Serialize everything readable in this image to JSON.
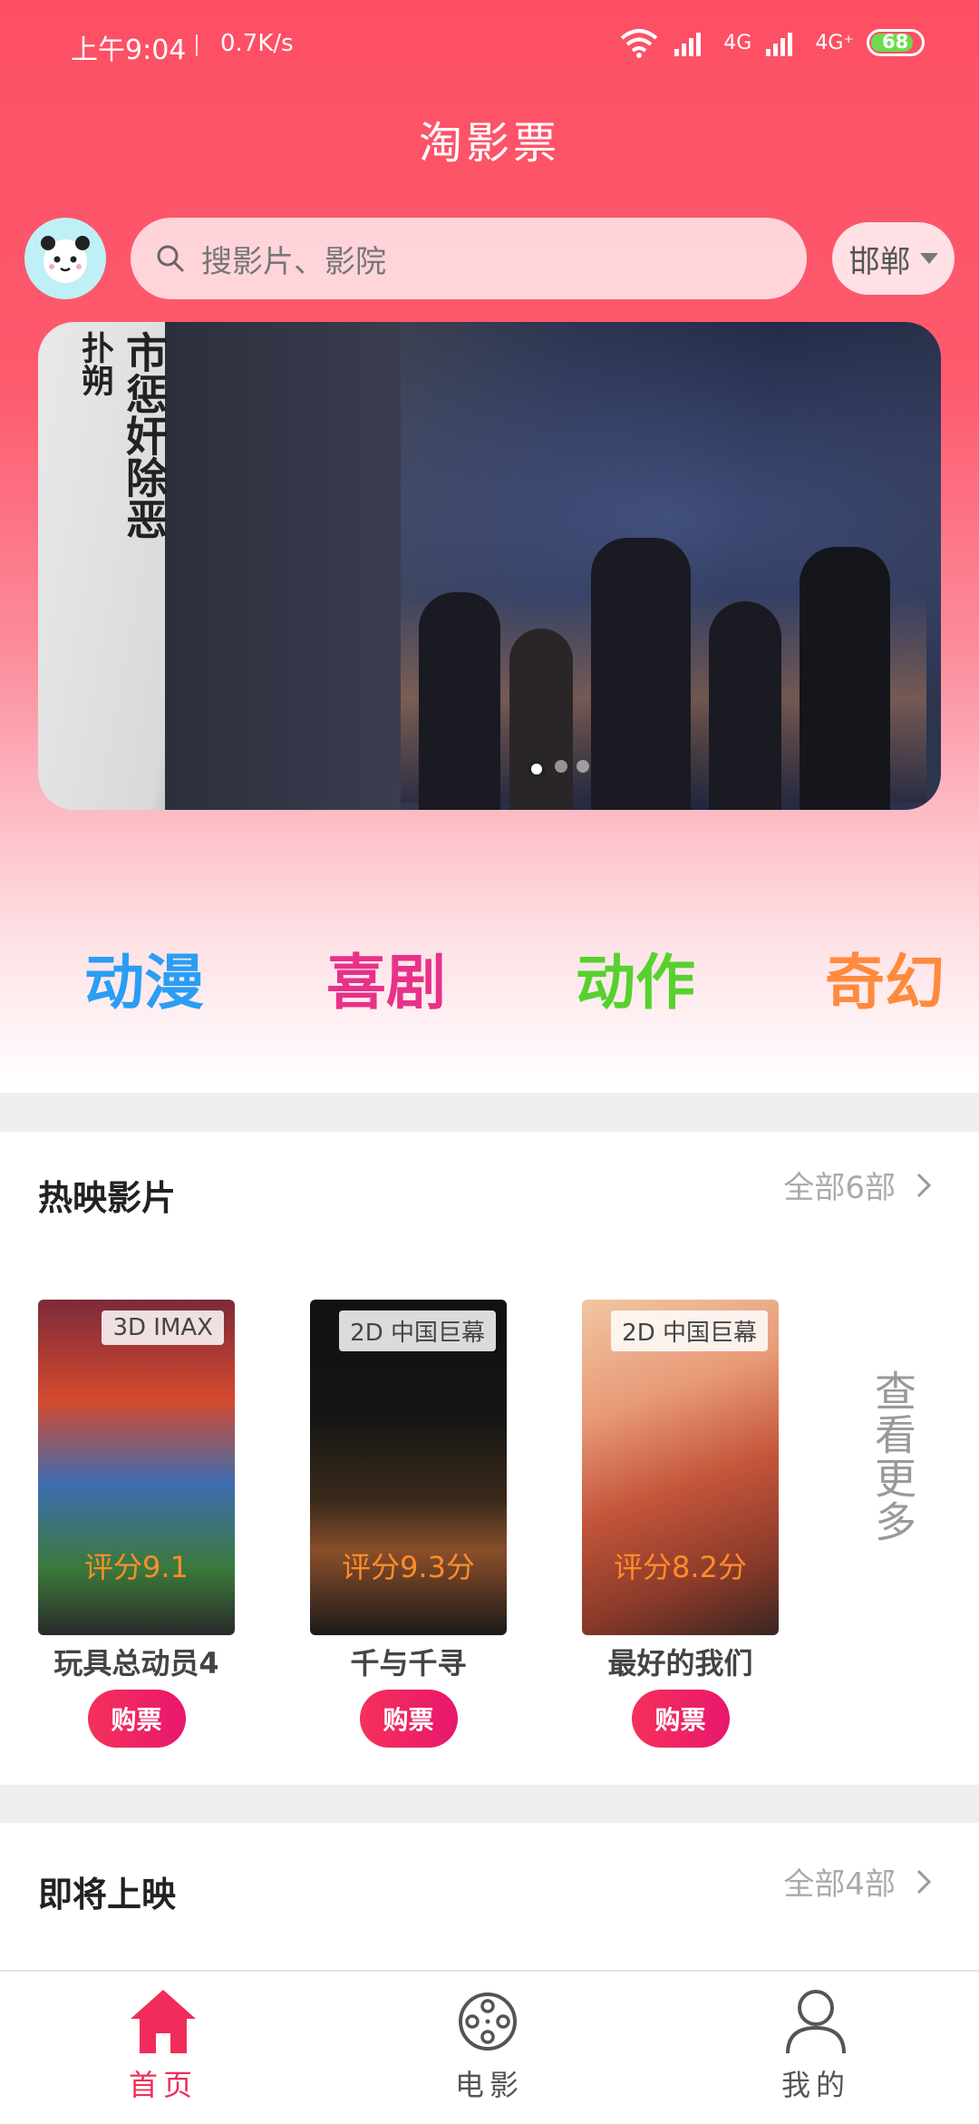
{
  "status_bar": {
    "time": "上午9:04",
    "speed": "0.7K/s",
    "network1": "4G",
    "network2": "4G⁺",
    "battery": "68"
  },
  "app": {
    "title": "淘影票"
  },
  "search": {
    "placeholder": "搜影片、影院"
  },
  "city": {
    "name": "邯郸"
  },
  "banner": {
    "text_main": "市惩奸除恶",
    "text_side": "扑朔",
    "slide_count": 3,
    "active_slide": 1
  },
  "categories": [
    {
      "label": "动漫",
      "color": "#2a9df4"
    },
    {
      "label": "喜剧",
      "color": "#e8318a"
    },
    {
      "label": "动作",
      "color": "#57d12e"
    },
    {
      "label": "奇幻",
      "color": "#ff8a3d"
    }
  ],
  "hot_section": {
    "title": "热映影片",
    "more": "全部6部",
    "see_more": "查看更多",
    "movies": [
      {
        "name": "玩具总动员4",
        "tag": "3D IMAX",
        "score": "评分9.1",
        "buy": "购票"
      },
      {
        "name": "千与千寻",
        "tag": "2D 中国巨幕",
        "score": "评分9.3分",
        "buy": "购票"
      },
      {
        "name": "最好的我们",
        "tag": "2D 中国巨幕",
        "score": "评分8.2分",
        "buy": "购票"
      }
    ]
  },
  "upcoming_section": {
    "title": "即将上映",
    "more": "全部4部"
  },
  "nav": [
    {
      "label": "首页",
      "icon": "home-icon",
      "active": true
    },
    {
      "label": "电影",
      "icon": "film-reel-icon",
      "active": false
    },
    {
      "label": "我的",
      "icon": "user-icon",
      "active": false
    }
  ],
  "colors": {
    "accent": "#fd4f64",
    "buy": "#ec1f63",
    "score": "#ff8c2a"
  }
}
